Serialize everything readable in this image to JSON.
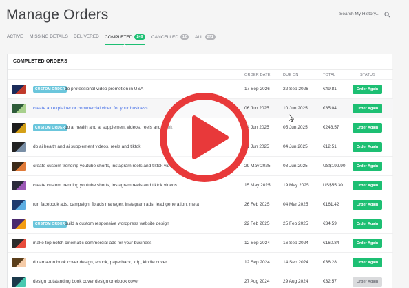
{
  "page": {
    "title": "Manage Orders",
    "search_placeholder": "Search My History..."
  },
  "tabs": [
    {
      "label": "ACTIVE",
      "badge": ""
    },
    {
      "label": "MISSING DETAILS",
      "badge": ""
    },
    {
      "label": "DELIVERED",
      "badge": ""
    },
    {
      "label": "COMPLETED",
      "badge": "249"
    },
    {
      "label": "CANCELLED",
      "badge": "12"
    },
    {
      "label": "ALL",
      "badge": "271"
    }
  ],
  "card": {
    "title": "COMPLETED ORDERS",
    "columns": [
      "ORDER DATE",
      "DUE ON",
      "TOTAL",
      "STATUS"
    ]
  },
  "rows": [
    {
      "tag": "CUSTOM ORDER",
      "gig": "do professional video promotion in USA",
      "order_date": "17 Sep 2026",
      "due_on": "22 Sep 2026",
      "total": "€49.81",
      "action": "Order Again"
    },
    {
      "tag": "",
      "gig": "create an explainer or commercial video for your business",
      "order_date": "06 Jun 2025",
      "due_on": "10 Jun 2025",
      "total": "€85.04",
      "action": "Order Again"
    },
    {
      "tag": "CUSTOM ORDER",
      "gig": "do ai health and ai supplement videos, reels and tiktok",
      "order_date": "04 Jun 2025",
      "due_on": "05 Jun 2025",
      "total": "€243.57",
      "action": "Order Again"
    },
    {
      "tag": "",
      "gig": "do ai health and ai supplement videos, reels and tiktok",
      "order_date": "01 Jun 2025",
      "due_on": "04 Jun 2025",
      "total": "€12.51",
      "action": "Order Again"
    },
    {
      "tag": "",
      "gig": "create custom trending youtube shorts, instagram reels and tiktok videos",
      "order_date": "29 May 2025",
      "due_on": "08 Jun 2025",
      "total": "US$192.90",
      "action": "Order Again"
    },
    {
      "tag": "",
      "gig": "create custom trending youtube shorts, instagram reels and tiktok videos",
      "order_date": "15 May 2025",
      "due_on": "19 May 2025",
      "total": "US$55.30",
      "action": "Order Again"
    },
    {
      "tag": "",
      "gig": "run facebook ads, campaign, fb ads manager, instagram ads, lead generation, meta",
      "order_date": "26 Feb 2025",
      "due_on": "04 Mar 2025",
      "total": "€161.42",
      "action": "Order Again"
    },
    {
      "tag": "CUSTOM ORDER",
      "gig": "build a custom responsive wordpress website design",
      "order_date": "22 Feb 2025",
      "due_on": "25 Feb 2025",
      "total": "€34.59",
      "action": "Order Again"
    },
    {
      "tag": "",
      "gig": "make top notch cinematic commercial ads for your business",
      "order_date": "12 Sep 2024",
      "due_on": "16 Sep 2024",
      "total": "€160.84",
      "action": "Order Again"
    },
    {
      "tag": "",
      "gig": "do amazon book cover design, ebook, paperback, kdp, kindle cover",
      "order_date": "12 Sep 2024",
      "due_on": "14 Sep 2024",
      "total": "€36.28",
      "action": "Order Again"
    },
    {
      "tag": "",
      "gig": "design outstanding book cover design or ebook cover",
      "order_date": "27 Aug 2024",
      "due_on": "29 Aug 2024",
      "total": "€32.57",
      "action": "Order Again"
    }
  ],
  "colors": {
    "accent_green": "#1dbf73",
    "custom_tag": "#6bc6dc",
    "play_red": "#e8393a",
    "link_blue": "#446ee7"
  },
  "icons": {
    "search": "search-icon",
    "play": "play-button-icon",
    "cursor": "mouse-cursor-icon"
  }
}
